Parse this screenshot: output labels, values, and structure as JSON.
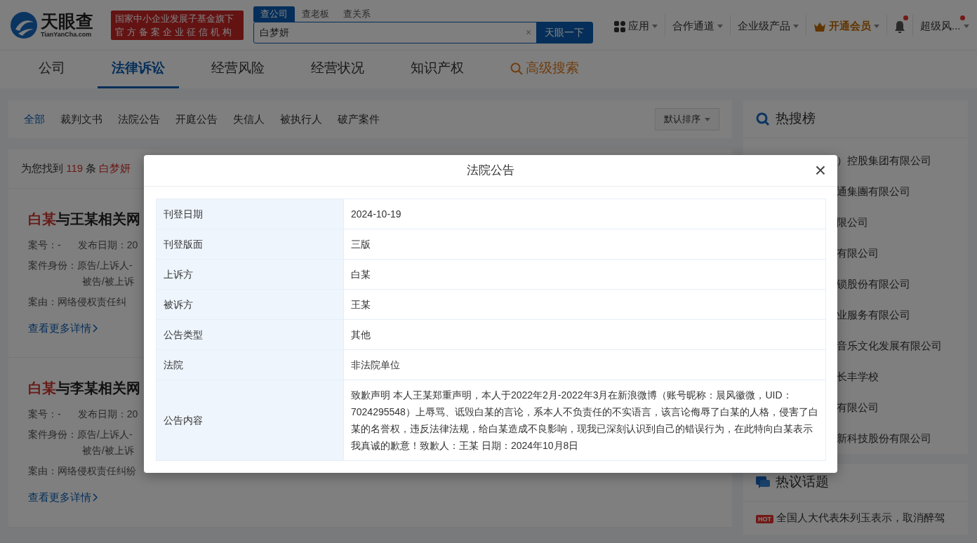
{
  "header": {
    "logo": {
      "name": "天眼查",
      "domain": "TianYanCha.com"
    },
    "badge_lines": [
      "国家中小企业发展子基金旗下",
      "官方备案企业征信机构"
    ],
    "search": {
      "tabs": [
        {
          "label": "查公司",
          "selected": true
        },
        {
          "label": "查老板",
          "selected": false
        },
        {
          "label": "查关系",
          "selected": false
        }
      ],
      "value": "白梦妍",
      "clear": "×",
      "button": "天眼一下"
    },
    "menu": [
      {
        "kind": "apps",
        "label": "应用"
      },
      {
        "kind": "plain",
        "label": "合作通道"
      },
      {
        "kind": "plain",
        "label": "企业级产品"
      },
      {
        "kind": "vip",
        "label": "开通会员"
      },
      {
        "kind": "bell",
        "notify": true
      },
      {
        "kind": "user",
        "label": "超级风...",
        "notify": true
      }
    ]
  },
  "main_tabs": [
    {
      "label": "公司",
      "selected": false,
      "kind": "plain"
    },
    {
      "label": "法律诉讼",
      "selected": true,
      "kind": "plain"
    },
    {
      "label": "经营风险",
      "selected": false,
      "kind": "plain"
    },
    {
      "label": "经营状况",
      "selected": false,
      "kind": "plain"
    },
    {
      "label": "知识产权",
      "selected": false,
      "kind": "plain"
    },
    {
      "label": "高级搜索",
      "selected": false,
      "kind": "search"
    }
  ],
  "filters": {
    "items": [
      {
        "label": "全部",
        "selected": true
      },
      {
        "label": "裁判文书",
        "selected": false
      },
      {
        "label": "法院公告",
        "selected": false
      },
      {
        "label": "开庭公告",
        "selected": false
      },
      {
        "label": "失信人",
        "selected": false
      },
      {
        "label": "被执行人",
        "selected": false
      },
      {
        "label": "破产案件",
        "selected": false
      }
    ],
    "sort": "默认排序"
  },
  "results": {
    "prefix": "为您找到",
    "count": "119",
    "unit": "条",
    "keyword": "白梦妍"
  },
  "cases": [
    {
      "highlight": "白某",
      "title": "与王某相关网",
      "case_no": "案号：-",
      "date": "发布日期：20",
      "role_label": "案件身份：",
      "roles": [
        "原告/上诉人-",
        "被告/被上诉"
      ],
      "cause": "案由：网络侵权责任纠",
      "link": "查看更多详情"
    },
    {
      "highlight": "白某",
      "title": "与李某相关网",
      "case_no": "案号：-",
      "date": "发布日期：20",
      "role_label": "案件身份：",
      "roles": [
        "原告/上诉人-",
        "被告/被上诉"
      ],
      "cause": "案由：网络侵权责任纠纷",
      "link": "查看更多详情"
    }
  ],
  "hot_search": {
    "title": "热搜榜",
    "items": [
      "）控股集团有限公司",
      "通集團有限公司",
      "限公司",
      "有限公司",
      "锁股份有限公司",
      "业服务有限公司",
      "音乐文化发展有限公司",
      "长丰学校",
      "有限公司",
      "新科技股份有限公司"
    ]
  },
  "hot_topics": {
    "title": "热议话题",
    "items": [
      {
        "badge": "HOT",
        "text": "全国人大代表朱列玉表示，取消醉驾"
      }
    ]
  },
  "modal": {
    "title": "法院公告",
    "close": "×",
    "rows": [
      {
        "label": "刊登日期",
        "value": "2024-10-19"
      },
      {
        "label": "刊登版面",
        "value": "三版"
      },
      {
        "label": "上诉方",
        "value": "白某"
      },
      {
        "label": "被诉方",
        "value": "王某"
      },
      {
        "label": "公告类型",
        "value": "其他"
      },
      {
        "label": "法院",
        "value": "非法院单位"
      },
      {
        "label": "公告内容",
        "value": "致歉声明 本人王某郑重声明，本人于2022年2月-2022年3月在新浪微博（账号昵称：晨风徽微，UID：7024295548）上辱骂、诋毁白某的言论，系本人不负责任的不实语言，该言论侮辱了白某的人格，侵害了白某的名誉权，违反法律法规，给白某造成不良影响，现我已深刻认识到自己的错误行为，在此特向白某表示我真诚的歉意！致歉人：王某 日期：2024年10月8日"
      }
    ]
  }
}
